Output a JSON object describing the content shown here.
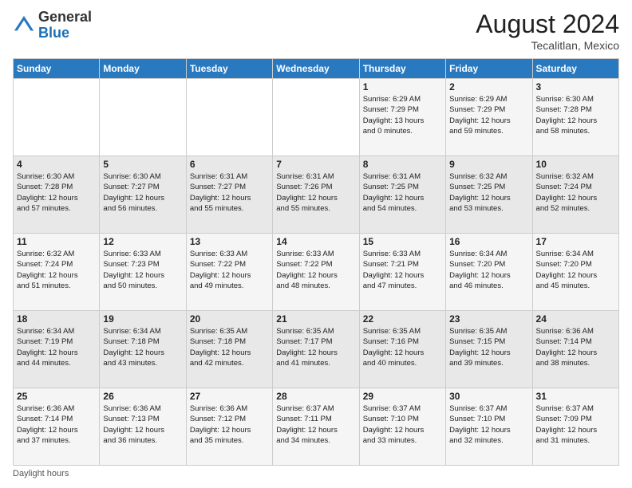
{
  "header": {
    "logo_general": "General",
    "logo_blue": "Blue",
    "month_year": "August 2024",
    "location": "Tecalitlan, Mexico"
  },
  "footer": {
    "daylight_label": "Daylight hours"
  },
  "weekdays": [
    "Sunday",
    "Monday",
    "Tuesday",
    "Wednesday",
    "Thursday",
    "Friday",
    "Saturday"
  ],
  "weeks": [
    [
      {
        "day": "",
        "info": ""
      },
      {
        "day": "",
        "info": ""
      },
      {
        "day": "",
        "info": ""
      },
      {
        "day": "",
        "info": ""
      },
      {
        "day": "1",
        "info": "Sunrise: 6:29 AM\nSunset: 7:29 PM\nDaylight: 13 hours\nand 0 minutes."
      },
      {
        "day": "2",
        "info": "Sunrise: 6:29 AM\nSunset: 7:29 PM\nDaylight: 12 hours\nand 59 minutes."
      },
      {
        "day": "3",
        "info": "Sunrise: 6:30 AM\nSunset: 7:28 PM\nDaylight: 12 hours\nand 58 minutes."
      }
    ],
    [
      {
        "day": "4",
        "info": "Sunrise: 6:30 AM\nSunset: 7:28 PM\nDaylight: 12 hours\nand 57 minutes."
      },
      {
        "day": "5",
        "info": "Sunrise: 6:30 AM\nSunset: 7:27 PM\nDaylight: 12 hours\nand 56 minutes."
      },
      {
        "day": "6",
        "info": "Sunrise: 6:31 AM\nSunset: 7:27 PM\nDaylight: 12 hours\nand 55 minutes."
      },
      {
        "day": "7",
        "info": "Sunrise: 6:31 AM\nSunset: 7:26 PM\nDaylight: 12 hours\nand 55 minutes."
      },
      {
        "day": "8",
        "info": "Sunrise: 6:31 AM\nSunset: 7:25 PM\nDaylight: 12 hours\nand 54 minutes."
      },
      {
        "day": "9",
        "info": "Sunrise: 6:32 AM\nSunset: 7:25 PM\nDaylight: 12 hours\nand 53 minutes."
      },
      {
        "day": "10",
        "info": "Sunrise: 6:32 AM\nSunset: 7:24 PM\nDaylight: 12 hours\nand 52 minutes."
      }
    ],
    [
      {
        "day": "11",
        "info": "Sunrise: 6:32 AM\nSunset: 7:24 PM\nDaylight: 12 hours\nand 51 minutes."
      },
      {
        "day": "12",
        "info": "Sunrise: 6:33 AM\nSunset: 7:23 PM\nDaylight: 12 hours\nand 50 minutes."
      },
      {
        "day": "13",
        "info": "Sunrise: 6:33 AM\nSunset: 7:22 PM\nDaylight: 12 hours\nand 49 minutes."
      },
      {
        "day": "14",
        "info": "Sunrise: 6:33 AM\nSunset: 7:22 PM\nDaylight: 12 hours\nand 48 minutes."
      },
      {
        "day": "15",
        "info": "Sunrise: 6:33 AM\nSunset: 7:21 PM\nDaylight: 12 hours\nand 47 minutes."
      },
      {
        "day": "16",
        "info": "Sunrise: 6:34 AM\nSunset: 7:20 PM\nDaylight: 12 hours\nand 46 minutes."
      },
      {
        "day": "17",
        "info": "Sunrise: 6:34 AM\nSunset: 7:20 PM\nDaylight: 12 hours\nand 45 minutes."
      }
    ],
    [
      {
        "day": "18",
        "info": "Sunrise: 6:34 AM\nSunset: 7:19 PM\nDaylight: 12 hours\nand 44 minutes."
      },
      {
        "day": "19",
        "info": "Sunrise: 6:34 AM\nSunset: 7:18 PM\nDaylight: 12 hours\nand 43 minutes."
      },
      {
        "day": "20",
        "info": "Sunrise: 6:35 AM\nSunset: 7:18 PM\nDaylight: 12 hours\nand 42 minutes."
      },
      {
        "day": "21",
        "info": "Sunrise: 6:35 AM\nSunset: 7:17 PM\nDaylight: 12 hours\nand 41 minutes."
      },
      {
        "day": "22",
        "info": "Sunrise: 6:35 AM\nSunset: 7:16 PM\nDaylight: 12 hours\nand 40 minutes."
      },
      {
        "day": "23",
        "info": "Sunrise: 6:35 AM\nSunset: 7:15 PM\nDaylight: 12 hours\nand 39 minutes."
      },
      {
        "day": "24",
        "info": "Sunrise: 6:36 AM\nSunset: 7:14 PM\nDaylight: 12 hours\nand 38 minutes."
      }
    ],
    [
      {
        "day": "25",
        "info": "Sunrise: 6:36 AM\nSunset: 7:14 PM\nDaylight: 12 hours\nand 37 minutes."
      },
      {
        "day": "26",
        "info": "Sunrise: 6:36 AM\nSunset: 7:13 PM\nDaylight: 12 hours\nand 36 minutes."
      },
      {
        "day": "27",
        "info": "Sunrise: 6:36 AM\nSunset: 7:12 PM\nDaylight: 12 hours\nand 35 minutes."
      },
      {
        "day": "28",
        "info": "Sunrise: 6:37 AM\nSunset: 7:11 PM\nDaylight: 12 hours\nand 34 minutes."
      },
      {
        "day": "29",
        "info": "Sunrise: 6:37 AM\nSunset: 7:10 PM\nDaylight: 12 hours\nand 33 minutes."
      },
      {
        "day": "30",
        "info": "Sunrise: 6:37 AM\nSunset: 7:10 PM\nDaylight: 12 hours\nand 32 minutes."
      },
      {
        "day": "31",
        "info": "Sunrise: 6:37 AM\nSunset: 7:09 PM\nDaylight: 12 hours\nand 31 minutes."
      }
    ]
  ]
}
